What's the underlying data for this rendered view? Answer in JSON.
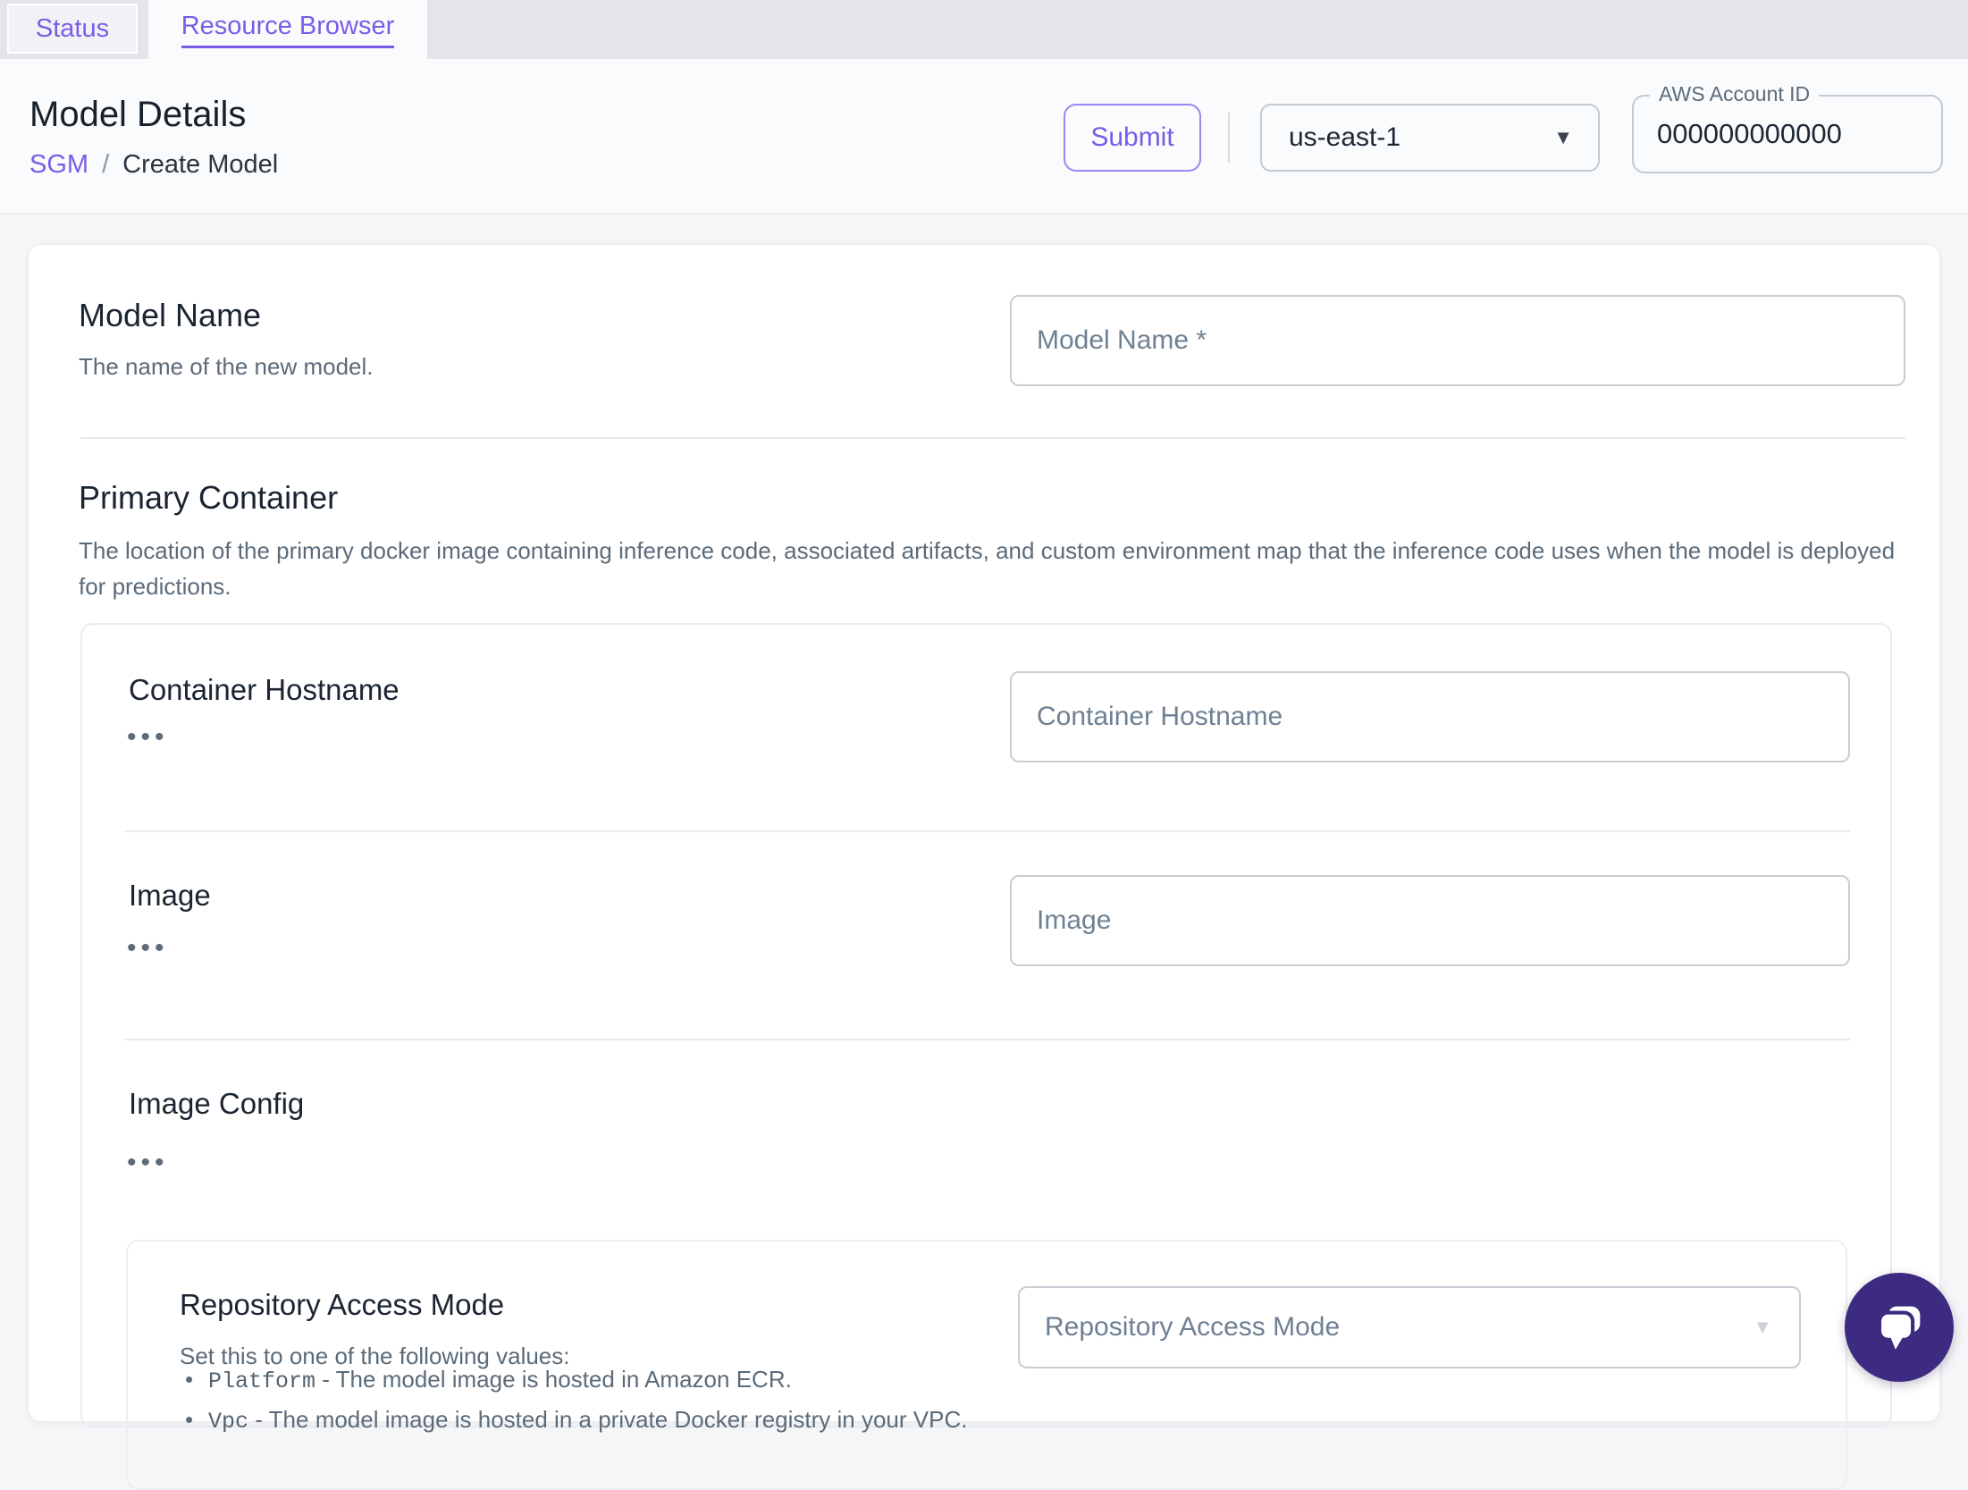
{
  "tabs": [
    {
      "label": "Status",
      "active": false
    },
    {
      "label": "Resource Browser",
      "active": true
    }
  ],
  "header": {
    "title": "Model Details",
    "breadcrumb": {
      "parent": "SGM",
      "separator": "/",
      "current": "Create Model"
    },
    "submit_label": "Submit",
    "region_select": {
      "value": "us-east-1"
    },
    "account_field": {
      "label": "AWS Account ID",
      "value": "000000000000"
    }
  },
  "form": {
    "model_name": {
      "label": "Model Name",
      "description": "The name of the new model.",
      "placeholder": "Model Name *"
    },
    "primary_container": {
      "label": "Primary Container",
      "description": "The location of the primary docker image containing inference code, associated artifacts, and custom environment map that the inference code uses when the model is deployed for predictions.",
      "container_hostname": {
        "label": "Container Hostname",
        "placeholder": "Container Hostname"
      },
      "image": {
        "label": "Image",
        "placeholder": "Image"
      },
      "image_config": {
        "label": "Image Config",
        "repository_access_mode": {
          "label": "Repository Access Mode",
          "placeholder": "Repository Access Mode",
          "description_intro": "Set this to one of the following values:",
          "options": [
            {
              "code": "Platform",
              "text": "- The model image is hosted in Amazon ECR."
            },
            {
              "code": "Vpc",
              "text": "- The model image is hosted in a private Docker registry in your VPC."
            }
          ]
        }
      }
    }
  },
  "icons": {
    "ellipsis": "•••",
    "caret_down": "▼"
  },
  "colors": {
    "accent_purple": "#7b5ce8",
    "chat_fab_purple": "#3c2b80",
    "tabbar_gray": "#e3e5e9",
    "header_bg": "#fafbfc",
    "text_primary": "#1b2531",
    "text_secondary": "#5b6b79",
    "input_border": "#c7cdd4"
  }
}
